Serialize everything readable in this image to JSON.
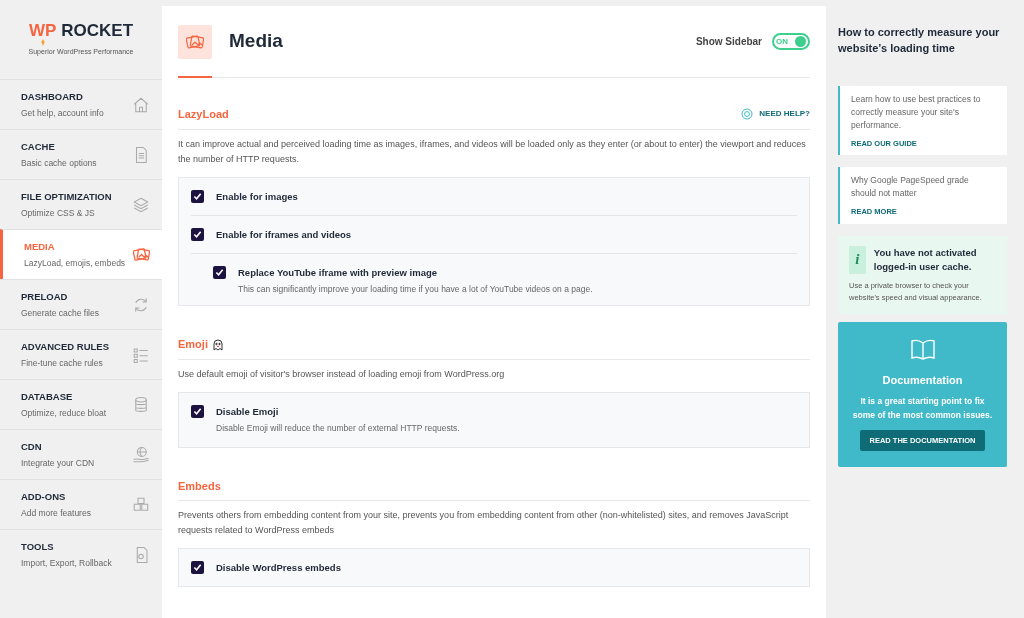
{
  "logo": {
    "mark": "WP",
    "name": "ROCKET",
    "tagline": "Superior WordPress Performance"
  },
  "nav": [
    {
      "title": "DASHBOARD",
      "subtitle": "Get help, account info",
      "selected": false
    },
    {
      "title": "CACHE",
      "subtitle": "Basic cache options",
      "selected": false
    },
    {
      "title": "FILE OPTIMIZATION",
      "subtitle": "Optimize CSS & JS",
      "selected": false
    },
    {
      "title": "MEDIA",
      "subtitle": "LazyLoad, emojis, embeds",
      "selected": true
    },
    {
      "title": "PRELOAD",
      "subtitle": "Generate cache files",
      "selected": false
    },
    {
      "title": "ADVANCED RULES",
      "subtitle": "Fine-tune cache rules",
      "selected": false
    },
    {
      "title": "DATABASE",
      "subtitle": "Optimize, reduce bloat",
      "selected": false
    },
    {
      "title": "CDN",
      "subtitle": "Integrate your CDN",
      "selected": false
    },
    {
      "title": "ADD-ONS",
      "subtitle": "Add more features",
      "selected": false
    },
    {
      "title": "TOOLS",
      "subtitle": "Import, Export, Rollback",
      "selected": false
    }
  ],
  "page": {
    "title": "Media",
    "sidebar_toggle": {
      "label": "Show Sidebar",
      "state": "ON",
      "on": true
    }
  },
  "sections": [
    {
      "title": "LazyLoad",
      "help": "NEED HELP?",
      "description": "It can improve actual and perceived loading time as images, iframes, and videos will be loaded only as they enter (or about to enter) the viewport and reduces the number of HTTP requests.",
      "options": [
        {
          "label": "Enable for images",
          "checked": true
        },
        {
          "label": "Enable for iframes and videos",
          "checked": true,
          "children": [
            {
              "label": "Replace YouTube iframe with preview image",
              "description": "This can significantly improve your loading time if you have a lot of YouTube videos on a page.",
              "checked": true
            }
          ]
        }
      ]
    },
    {
      "title": "Emoji",
      "description": "Use default emoji of visitor's browser instead of loading emoji from WordPress.org",
      "options": [
        {
          "label": "Disable Emoji",
          "description": "Disable Emoji will reduce the number of external HTTP requests.",
          "checked": true
        }
      ]
    },
    {
      "title": "Embeds",
      "description": "Prevents others from embedding content from your site, prevents you from embedding content from other (non-whitelisted) sites, and removes JavaScript requests related to WordPress embeds",
      "options": [
        {
          "label": "Disable WordPress embeds",
          "checked": true
        }
      ]
    }
  ],
  "sidebar": {
    "heading": "How to correctly measure your website’s loading time",
    "articles": [
      {
        "text": "Learn how to use best practices to correctly measure your site's performance.",
        "link": "READ OUR GUIDE"
      },
      {
        "text": "Why Google PageSpeed grade should not matter",
        "link": "READ MORE"
      }
    ],
    "notice": {
      "icon": "i",
      "title": "You have not activated logged-in user cache.",
      "text": "Use a private browser to check your website's speed and visual appearance."
    },
    "documentation": {
      "title": "Documentation",
      "text": "It is a great starting point to fix some of the most common issues.",
      "button": "READ THE DOCUMENTATION"
    }
  }
}
